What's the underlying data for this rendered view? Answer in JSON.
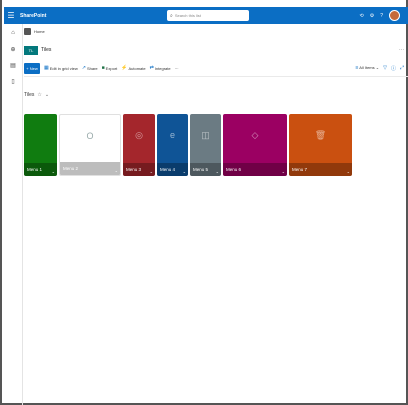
{
  "topbar": {
    "app_name": "SharePoint",
    "search_placeholder": "Search this list",
    "icons": [
      "waffle-icon",
      "chat-icon",
      "settings-icon",
      "help-icon",
      "avatar"
    ]
  },
  "breadcrumb": {
    "label": "Home"
  },
  "site": {
    "logo_text": "TL",
    "name": "Tiles"
  },
  "commandbar": {
    "new_label": "New",
    "items": [
      {
        "label": "Edit in grid view",
        "icon": "grid-icon"
      },
      {
        "label": "Share",
        "icon": "share-icon"
      },
      {
        "label": "Export",
        "icon": "excel-icon"
      },
      {
        "label": "Automate",
        "icon": "automate-icon"
      },
      {
        "label": "Integrate",
        "icon": "integrate-icon"
      }
    ],
    "more": "···",
    "view_label": "All Items",
    "view_icons": [
      "filter-icon",
      "info-icon",
      "fullscreen-icon"
    ]
  },
  "list": {
    "title": "Tiles"
  },
  "tiles": [
    {
      "label": "Menu 1",
      "color": "#107c10",
      "icon": ""
    },
    {
      "label": "Menu 2",
      "color": "#ffffff",
      "icon": "O"
    },
    {
      "label": "Menu 3",
      "color": "#a4262c",
      "icon": "◎"
    },
    {
      "label": "Menu 4",
      "color": "#0f5496",
      "icon": "e"
    },
    {
      "label": "Menu 5",
      "color": "#6b7b83",
      "icon": "◫"
    },
    {
      "label": "Menu 6",
      "color": "#9b0062",
      "icon": "◇"
    },
    {
      "label": "Menu 7",
      "color": "#ca5010",
      "icon": "🗑"
    }
  ]
}
